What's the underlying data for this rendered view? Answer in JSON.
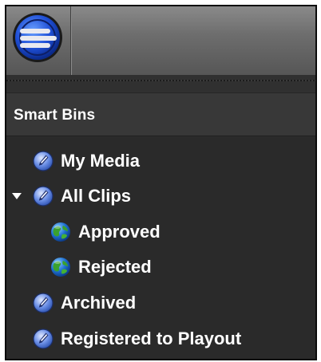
{
  "app": {
    "logo_icon": "app-logo-icon"
  },
  "panel": {
    "section_title": "Smart Bins"
  },
  "tree": {
    "items": [
      {
        "label": "My Media",
        "icon": "smart-bin-icon",
        "level": 0,
        "expandable": false
      },
      {
        "label": "All Clips",
        "icon": "smart-bin-icon",
        "level": 0,
        "expandable": true,
        "expanded": true
      },
      {
        "label": "Approved",
        "icon": "globe-icon",
        "level": 1,
        "expandable": false
      },
      {
        "label": "Rejected",
        "icon": "globe-icon",
        "level": 1,
        "expandable": false
      },
      {
        "label": "Archived",
        "icon": "smart-bin-icon",
        "level": 0,
        "expandable": false
      },
      {
        "label": "Registered to Playout",
        "icon": "smart-bin-icon",
        "level": 0,
        "expandable": false
      }
    ]
  },
  "colors": {
    "panel_bg": "#2a2a2a",
    "header_bg": "#383838",
    "toolbar_bg": "#6e6e6e",
    "text": "#ffffff",
    "bin_icon_blue": "#2f5fbf",
    "globe_green": "#3aa12e",
    "globe_blue": "#1e6fd0"
  }
}
